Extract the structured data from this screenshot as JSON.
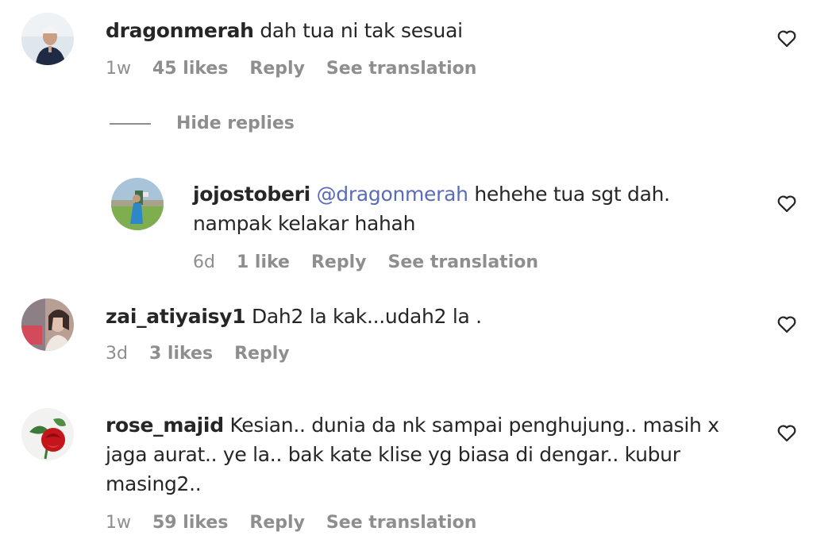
{
  "comments": [
    {
      "username": "dragonmerah",
      "text": "dah tua ni tak sesuai",
      "time": "1w",
      "likes": "45 likes",
      "reply": "Reply",
      "translate": "See translation"
    },
    {
      "username": "zai_atiyaisy1",
      "text": "Dah2 la kak...udah2 la .",
      "time": "3d",
      "likes": "3 likes",
      "reply": "Reply"
    },
    {
      "username": "rose_majid",
      "text_line1": "Kesian.. dunia da nk sampai penghujung.. masih x",
      "text_line2": "jaga aurat.. ye la.. bak kate klise yg biasa di dengar.. kubur",
      "text_line3": "masing2..",
      "time": "1w",
      "likes": "59 likes",
      "reply": "Reply",
      "translate": "See translation"
    }
  ],
  "hide_replies": "Hide replies",
  "reply": {
    "username": "jojostoberi",
    "mention": "@dragonmerah",
    "text_line1": "hehehe tua sgt dah.",
    "text_line2": "nampak kelakar hahah",
    "time": "6d",
    "likes": "1 like",
    "reply": "Reply",
    "translate": "See translation"
  },
  "colors": {
    "text": "#262626",
    "secondary": "#8e8e8e",
    "mention": "#5a6cb8"
  },
  "icons": [
    "heart-icon"
  ]
}
